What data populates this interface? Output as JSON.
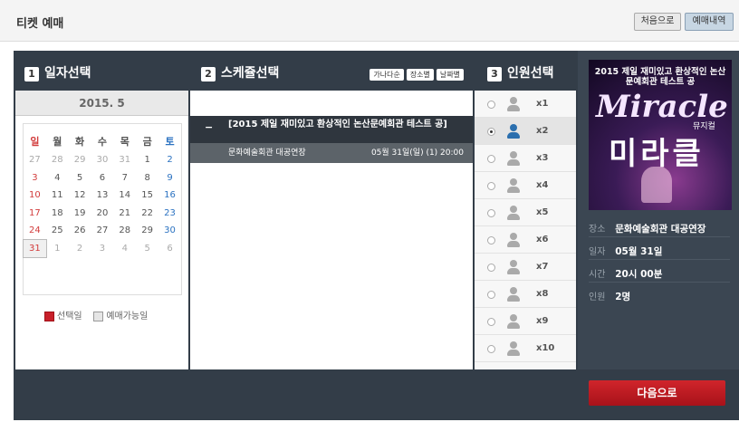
{
  "header": {
    "title": "티켓 예매",
    "home_label": "처음으로",
    "history_label": "예매내역"
  },
  "steps": [
    {
      "num": "1",
      "label": "일자선택"
    },
    {
      "num": "2",
      "label": "스케쥴선택"
    },
    {
      "num": "3",
      "label": "인원선택"
    }
  ],
  "sort": [
    "가나다순",
    "장소별",
    "날짜별"
  ],
  "calendar": {
    "month": "2015. 5",
    "weekdays": [
      "일",
      "월",
      "화",
      "수",
      "목",
      "금",
      "토"
    ],
    "weeks": [
      [
        "27",
        "28",
        "29",
        "30",
        "31",
        "1",
        "2"
      ],
      [
        "3",
        "4",
        "5",
        "6",
        "7",
        "8",
        "9"
      ],
      [
        "10",
        "11",
        "12",
        "13",
        "14",
        "15",
        "16"
      ],
      [
        "17",
        "18",
        "19",
        "20",
        "21",
        "22",
        "23"
      ],
      [
        "24",
        "25",
        "26",
        "27",
        "28",
        "29",
        "30"
      ],
      [
        "31",
        "1",
        "2",
        "3",
        "4",
        "5",
        "6"
      ]
    ],
    "legend_selected": "선택일",
    "legend_available": "예매가능일",
    "colors": {
      "selected": "#c8202a",
      "available": "#e6e6e6"
    }
  },
  "schedule": {
    "show_title": "[2015 제일 재미있고 환상적인 논산문예회관 테스트 공]",
    "venue": "문화예술회관 대공연장",
    "datetime": "05월 31일(일) (1) 20:00"
  },
  "persons": [
    "x1",
    "x2",
    "x3",
    "x4",
    "x5",
    "x6",
    "x7",
    "x8",
    "x9",
    "x10"
  ],
  "selected_person_index": 1,
  "poster": {
    "title": "2015 제일 재미있고 환상적인 논산문예회관 테스트 공",
    "en": "Miracle",
    "genre": "뮤지컬",
    "ko": "미라클"
  },
  "info": {
    "venue_k": "장소",
    "venue_v": "문화예술회관 대공연장",
    "date_k": "일자",
    "date_v": "05월 31일",
    "time_k": "시간",
    "time_v": "20시 00분",
    "people_k": "인원",
    "people_v": "2명"
  },
  "next_label": "다음으로"
}
